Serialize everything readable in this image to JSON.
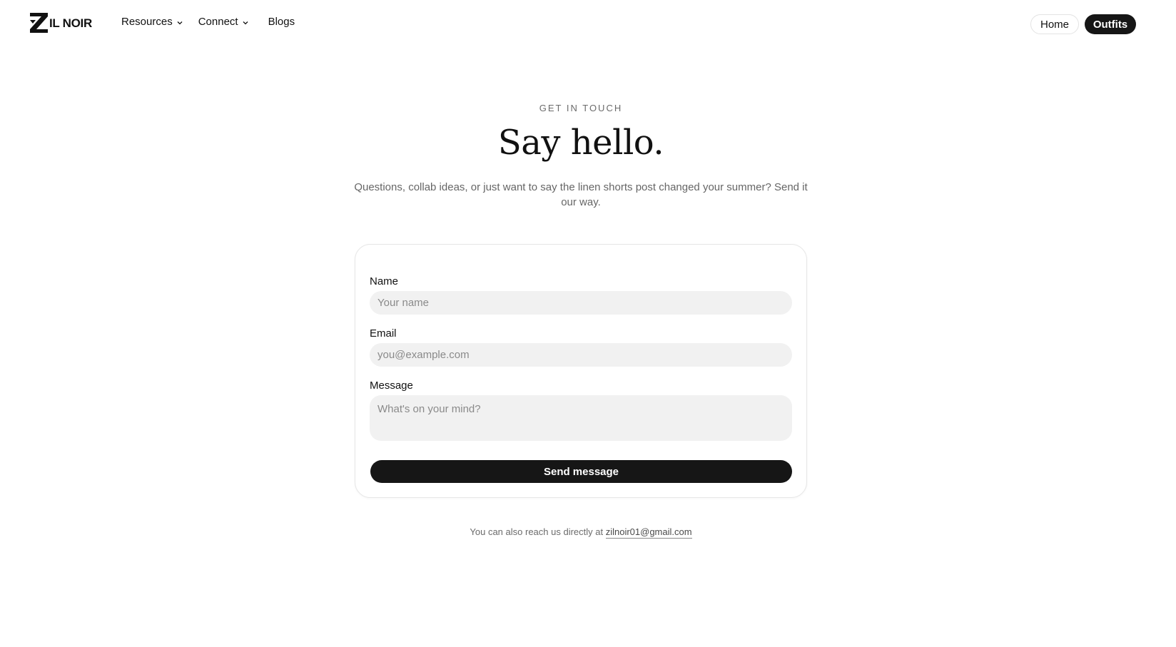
{
  "header": {
    "logo_text": "IL NOIR",
    "nav": {
      "resources": "Resources",
      "connect": "Connect",
      "blogs": "Blogs"
    },
    "home_label": "Home",
    "outfits_label": "Outfits"
  },
  "hero": {
    "eyebrow": "GET IN TOUCH",
    "title": "Say hello.",
    "subtitle": "Questions, collab ideas, or just want to say the linen shorts post changed your summer? Send it our way."
  },
  "form": {
    "name_label": "Name",
    "name_placeholder": "Your name",
    "email_label": "Email",
    "email_placeholder": "you@example.com",
    "message_label": "Message",
    "message_placeholder": "What's on your mind?",
    "submit_label": "Send message"
  },
  "footer": {
    "note_prefix": "You can also reach us directly at",
    "email_link": "zilnoir01@gmail.com"
  },
  "colors": {
    "accent_dark": "#161616",
    "field_bg": "#f1f1f1",
    "muted_text": "#666666"
  }
}
